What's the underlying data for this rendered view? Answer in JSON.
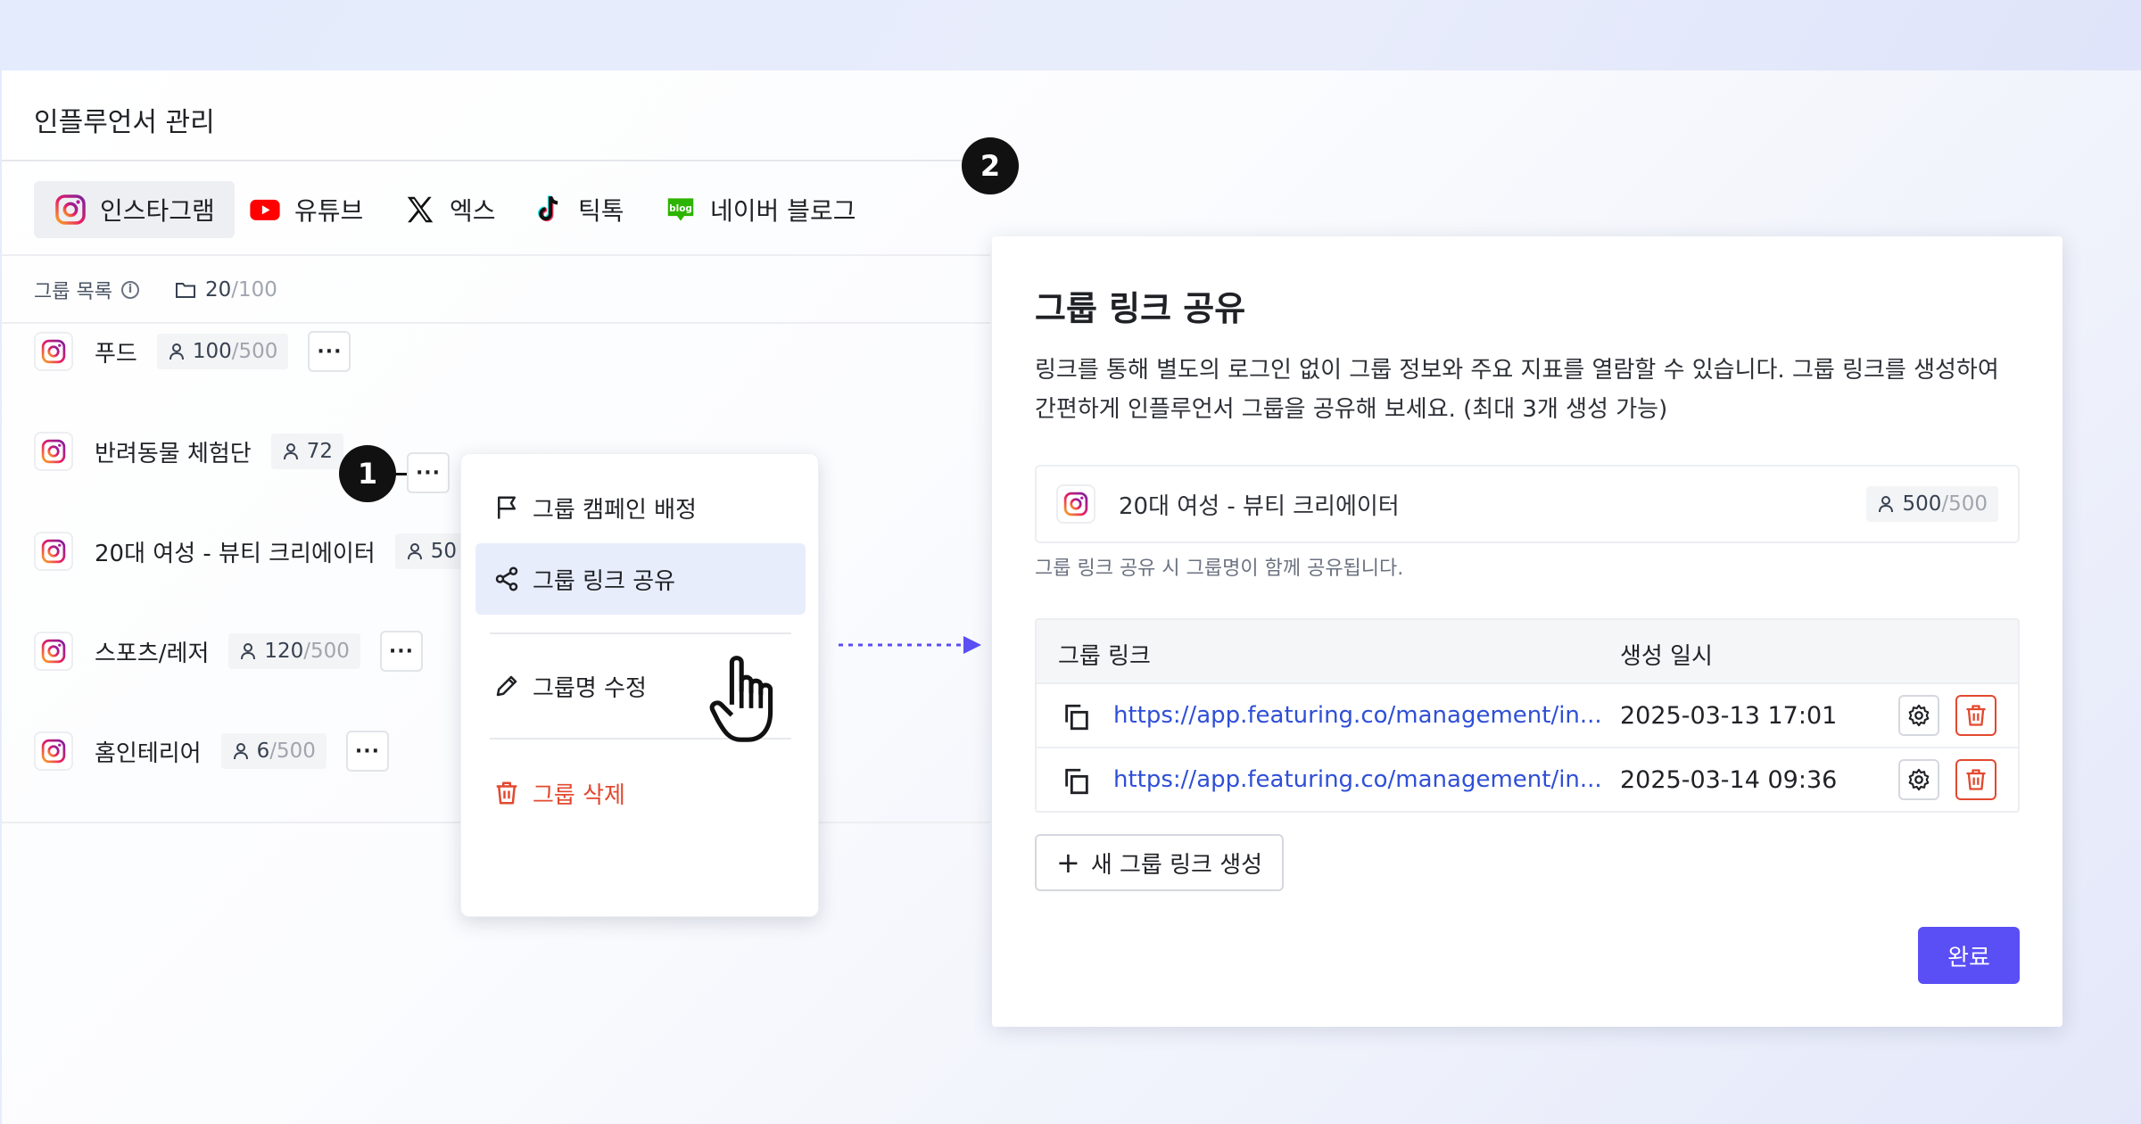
{
  "header": {
    "title": "인플루언서 관리"
  },
  "tabs": [
    {
      "label": "인스타그램",
      "icon": "instagram-icon",
      "active": true
    },
    {
      "label": "유튜브",
      "icon": "youtube-icon",
      "active": false
    },
    {
      "label": "엑스",
      "icon": "x-icon",
      "active": false
    },
    {
      "label": "틱톡",
      "icon": "tiktok-icon",
      "active": false
    },
    {
      "label": "네이버 블로그",
      "icon": "naver-blog-icon",
      "active": false
    }
  ],
  "naver_icon_text": "blog",
  "group_list": {
    "label": "그룹 목록",
    "info_icon": "i",
    "count": "20",
    "limit": "/100",
    "more_label": "···",
    "groups": [
      {
        "name": "푸드",
        "count": "100",
        "limit": "/500"
      },
      {
        "name": "반려동물 체험단",
        "count": "72",
        "limit": ""
      },
      {
        "name": "20대 여성 - 뷰티 크리에이터",
        "count": "50",
        "limit": ""
      },
      {
        "name": "스포츠/레저",
        "count": "120",
        "limit": "/500"
      },
      {
        "name": "홈인테리어",
        "count": "6",
        "limit": "/500"
      }
    ]
  },
  "context_menu": {
    "items": [
      {
        "label": "그룹 캠페인 배정",
        "icon": "flag-icon"
      },
      {
        "label": "그룹 링크 공유",
        "icon": "share-icon"
      },
      {
        "label": "그룹명 수정",
        "icon": "pencil-icon"
      },
      {
        "label": "그룹 삭제",
        "icon": "trash-icon"
      }
    ]
  },
  "steps": {
    "one": "1",
    "two": "2"
  },
  "modal": {
    "title": "그룹 링크 공유",
    "description": "링크를 통해 별도의 로그인 없이 그룹 정보와 주요 지표를 열람할 수 있습니다. 그룹 링크를 생성하여 간편하게 인플루언서 그룹을 공유해 보세요. (최대 3개 생성 가능)",
    "group_name": "20대 여성 - 뷰티 크리에이터",
    "group_count": "500",
    "group_limit": "/500",
    "note": "그룹 링크 공유 시 그룹명이 함께 공유됩니다.",
    "table": {
      "col_link": "그룹 링크",
      "col_date": "생성 일시",
      "rows": [
        {
          "url": "https://app.featuring.co/management/in...",
          "created": "2025-03-13 17:01"
        },
        {
          "url": "https://app.featuring.co/management/in...",
          "created": "2025-03-14 09:36"
        }
      ]
    },
    "new_link_icon": "+",
    "new_link_label": "새 그룹 링크 생성",
    "done_label": "완료"
  },
  "colors": {
    "accent": "#5a4ef5",
    "link": "#2f4fd6",
    "danger": "#e2492f",
    "highlight": "#e8edfc"
  }
}
